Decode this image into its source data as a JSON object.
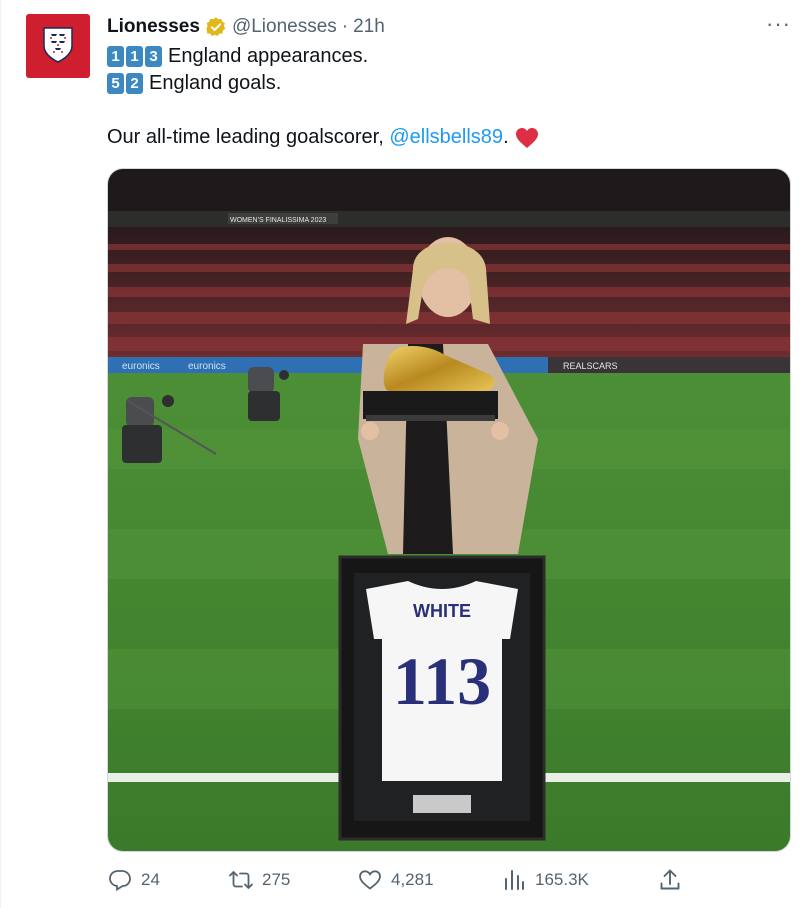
{
  "author": {
    "name": "Lionesses",
    "handle": "@Lionesses",
    "separator": "·",
    "time": "21h",
    "verified_icon": "gold-verified-badge",
    "avatar_icon": "england-crest"
  },
  "more_label": "···",
  "tweet": {
    "line1": {
      "keycaps": [
        "1",
        "1",
        "3"
      ],
      "text": "England appearances."
    },
    "line2": {
      "keycaps": [
        "5",
        "2"
      ],
      "text": "England goals."
    },
    "line3": {
      "text": "Our all-time leading goalscorer, ",
      "mention": "@ellsbells89",
      "suffix": ".",
      "emoji": "red-heart"
    }
  },
  "media": {
    "jersey_name": "WHITE",
    "jersey_number": "113",
    "board_text": "WOMEN'S FINALISSIMA 2023",
    "ad_text_1": "euronics",
    "ad_text_2": "euronics",
    "ad_text_3": "REALSCARS"
  },
  "actions": {
    "reply_count": "24",
    "retweet_count": "275",
    "like_count": "4,281",
    "view_count": "165.3K"
  },
  "colors": {
    "accent": "#1d9bf0",
    "secondary_text": "#536471",
    "pitch_green": "#3f8a2e",
    "avatar_red": "#cf1f2e"
  }
}
